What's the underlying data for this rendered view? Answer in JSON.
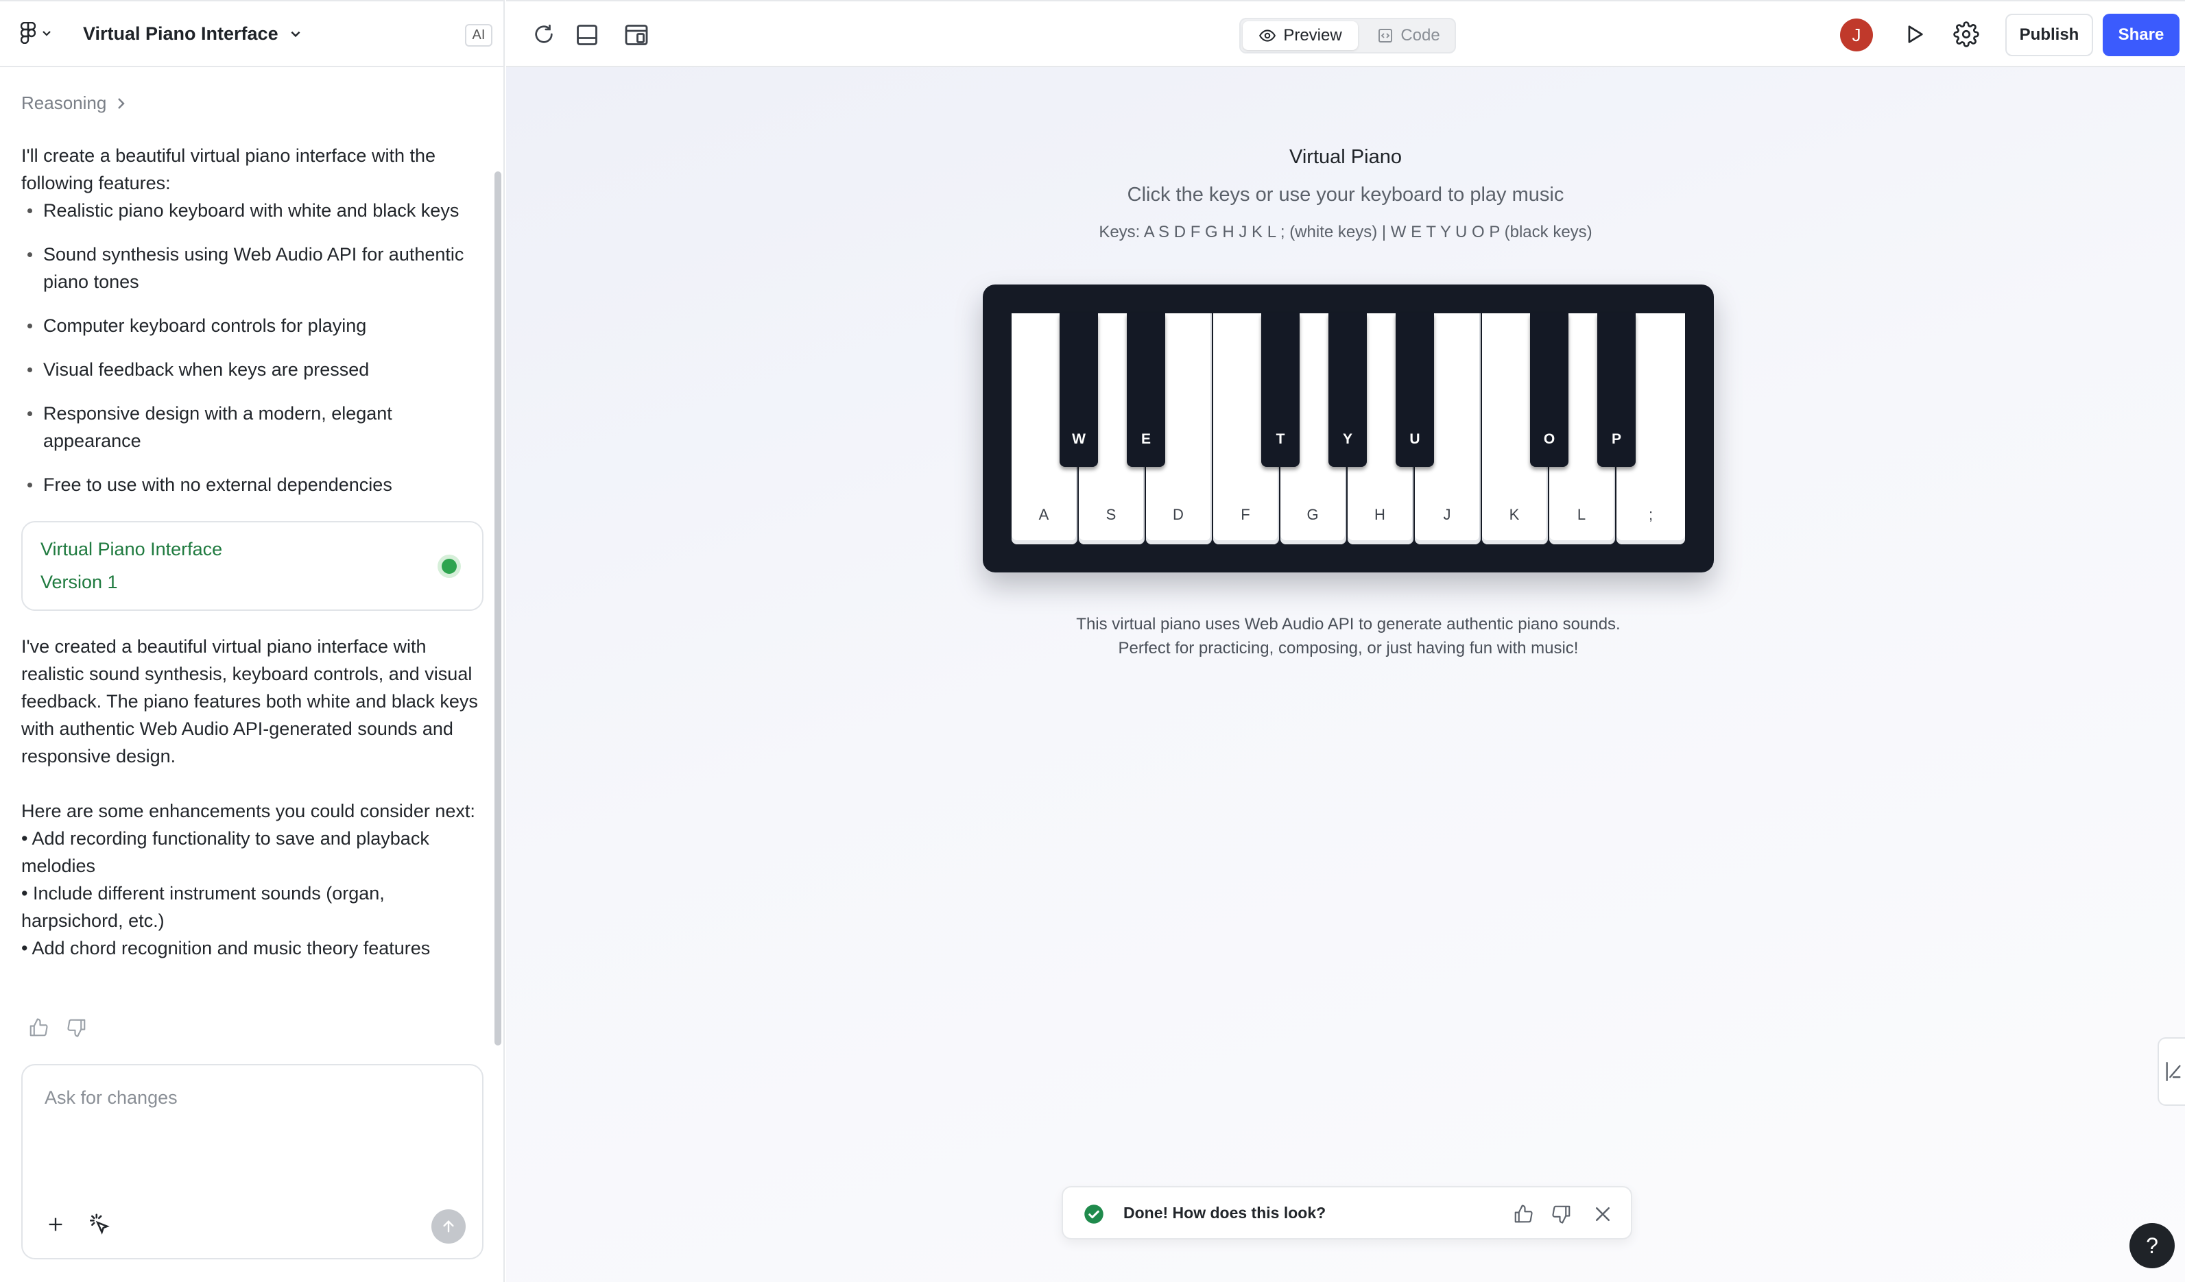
{
  "header": {
    "project_title": "Virtual Piano Interface",
    "ai_badge": "AI"
  },
  "sidebar": {
    "reasoning_label": "Reasoning",
    "intro": "I'll create a beautiful virtual piano interface with the following features:",
    "features": [
      "Realistic piano keyboard with white and black keys",
      "Sound synthesis using Web Audio API for authentic piano tones",
      "Computer keyboard controls for playing",
      "Visual feedback when keys are pressed",
      "Responsive design with a modern, elegant appearance",
      "Free to use with no external dependencies"
    ],
    "version_card": {
      "title": "Virtual Piano Interface",
      "version": "Version 1",
      "status_color": "#2ea44f"
    },
    "summary": "I've created a beautiful virtual piano interface with realistic sound synthesis, keyboard controls, and visual feedback. The piano features both white and black keys with authentic Web Audio API-generated sounds and responsive design.",
    "enhancements_intro": "Here are some enhancements you could consider next:",
    "enhancements": [
      "• Add recording functionality to save and playback melodies",
      "• Include different instrument sounds (organ, harpsichord, etc.)",
      "• Add chord recognition and music theory features"
    ],
    "input_placeholder": "Ask for changes"
  },
  "toolbar": {
    "preview_label": "Preview",
    "code_label": "Code",
    "avatar_initial": "J",
    "avatar_color": "#c0392b",
    "publish_label": "Publish",
    "share_label": "Share",
    "share_color": "#3b5bfd"
  },
  "preview": {
    "title": "Virtual Piano",
    "subtitle": "Click the keys or use your keyboard to play music",
    "keys_hint": "Keys: A S D F G H J K L ; (white keys) | W E T Y U O P (black keys)",
    "white_keys": [
      "A",
      "S",
      "D",
      "F",
      "G",
      "H",
      "J",
      "K",
      "L",
      ";"
    ],
    "black_keys": [
      "W",
      "E",
      "T",
      "Y",
      "U",
      "O",
      "P"
    ],
    "description": "This virtual piano uses Web Audio API to generate authentic piano sounds. Perfect for practicing, composing, or just having fun with music!"
  },
  "toast": {
    "message": "Done! How does this look?"
  },
  "help_label": "?"
}
